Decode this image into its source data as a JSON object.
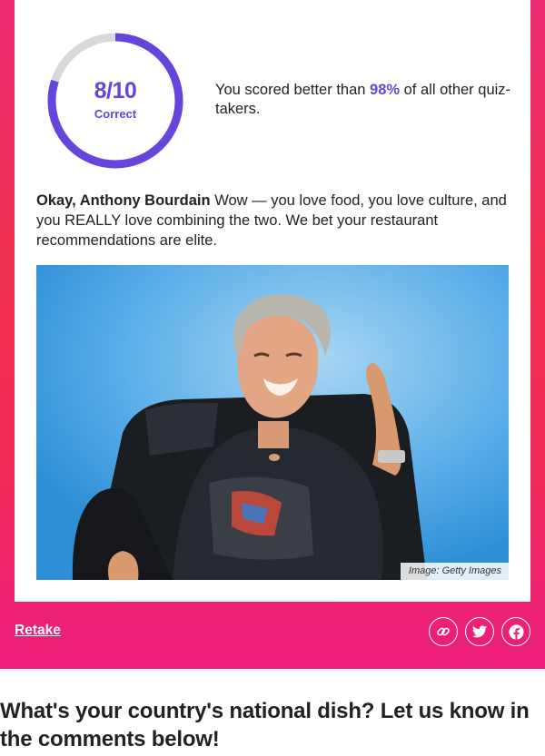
{
  "result": {
    "score": "8/10",
    "score_caption": "Correct",
    "score_fraction": 0.8,
    "comparison_prefix": "You scored better than ",
    "comparison_percent": "98%",
    "comparison_suffix": " of all other quiz-takers.",
    "title": "Okay, Anthony Bourdain",
    "description": " Wow — you love food, you love culture, and you REALLY love combining the two. We bet your restaurant recommendations are elite.",
    "image_credit": "Image: Getty Images"
  },
  "actions": {
    "retake_label": "Retake",
    "share_icons": [
      "link-icon",
      "twitter-icon",
      "facebook-icon"
    ]
  },
  "footer": {
    "heading": "What's your country's national dish? Let us know in the comments below!"
  },
  "colors": {
    "accent": "#6645dd",
    "panel_pink": "#ec2a73",
    "panel_red": "#f0304f"
  }
}
